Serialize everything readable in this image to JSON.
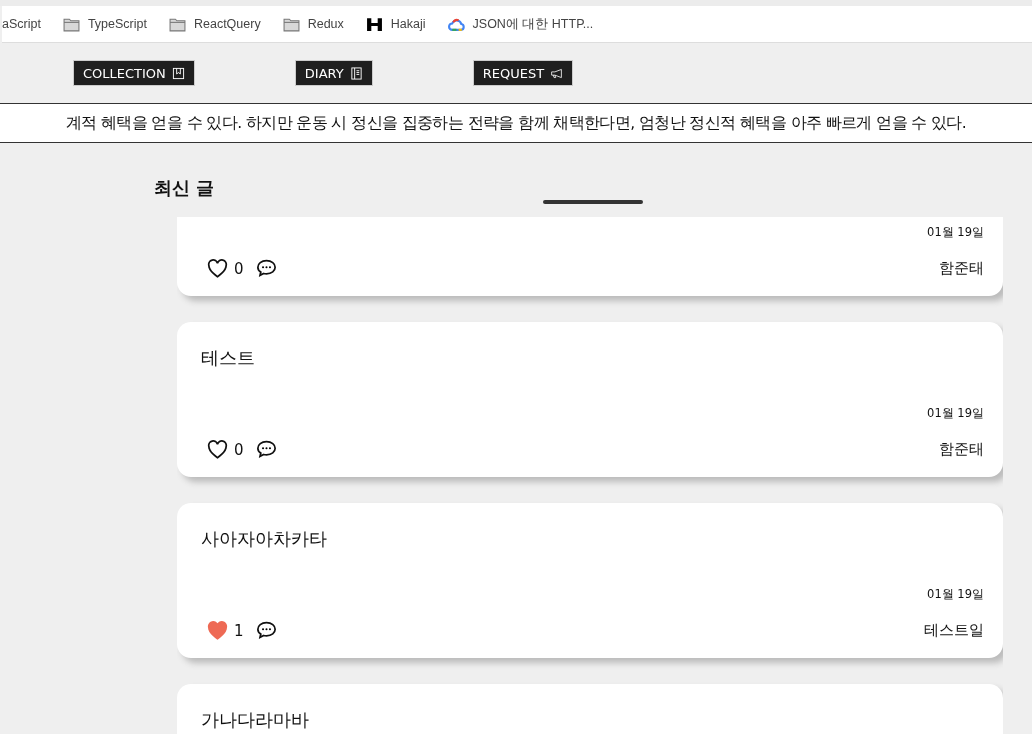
{
  "bookmarks": [
    {
      "label": "aScript",
      "kind": "plain"
    },
    {
      "label": "TypeScript",
      "kind": "folder"
    },
    {
      "label": "ReactQuery",
      "kind": "folder"
    },
    {
      "label": "Redux",
      "kind": "folder"
    },
    {
      "label": "Hakaji",
      "kind": "site"
    },
    {
      "label": "JSON에 대한 HTTP...",
      "kind": "doc"
    }
  ],
  "nav": [
    {
      "label": "COLLECTION"
    },
    {
      "label": "DIARY"
    },
    {
      "label": "REQUEST"
    }
  ],
  "marquee": "계적 혜택을 얻을 수 있다. 하지만 운동 시 정신을 집중하는 전략을 함께 채택한다면, 엄청난 정신적 혜택을 아주 빠르게 얻을 수 있다.",
  "section_title": "최신 글",
  "posts": [
    {
      "date": "01월 19일",
      "liked": false,
      "likes": "0",
      "author": "함준태"
    },
    {
      "title": "테스트",
      "date": "01월 19일",
      "liked": false,
      "likes": "0",
      "author": "함준태"
    },
    {
      "title": "사아자아차카타",
      "date": "01월 19일",
      "liked": true,
      "likes": "1",
      "author": "테스트일"
    },
    {
      "title": "가나다라마바"
    }
  ]
}
